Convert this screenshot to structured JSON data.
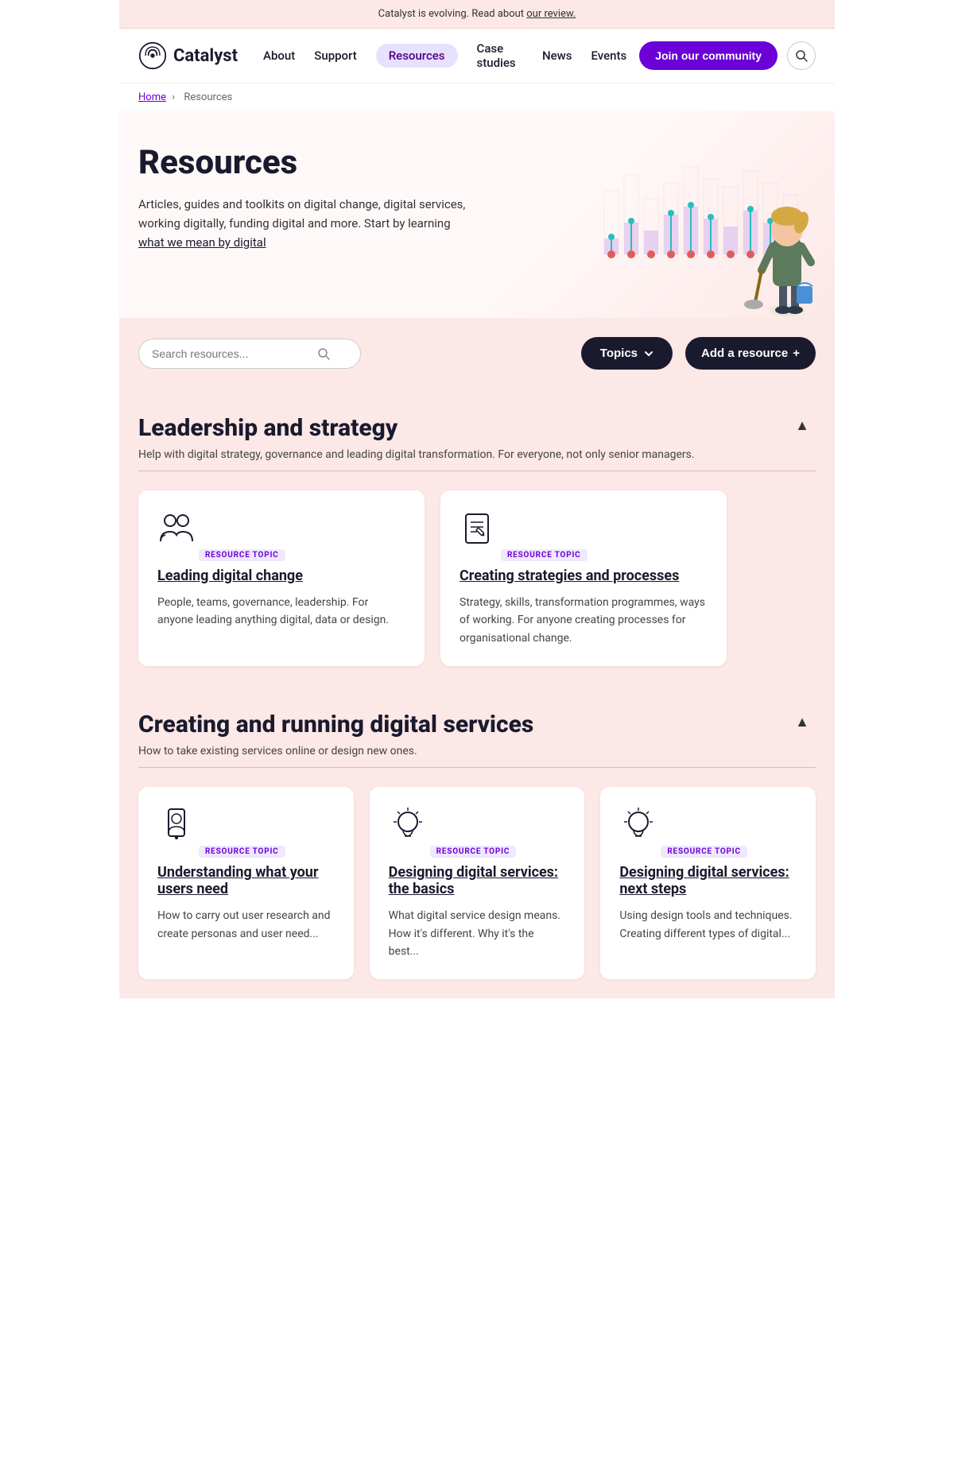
{
  "banner": {
    "text": "Catalyst is evolving. Read about ",
    "link_text": "our review.",
    "link_href": "#"
  },
  "nav": {
    "logo_text": "Catalyst",
    "links": [
      {
        "label": "About",
        "active": false
      },
      {
        "label": "Support",
        "active": false
      },
      {
        "label": "Resources",
        "active": true
      },
      {
        "label": "Case studies",
        "active": false
      },
      {
        "label": "News",
        "active": false
      },
      {
        "label": "Events",
        "active": false
      }
    ],
    "join_label": "Join our community"
  },
  "breadcrumb": {
    "home": "Home",
    "current": "Resources"
  },
  "hero": {
    "title": "Resources",
    "description": "Articles, guides and toolkits on digital change, digital services, working digitally, funding digital and more. Start by learning ",
    "link_text": "what we mean by digital"
  },
  "search": {
    "placeholder": "Search resources...",
    "topics_label": "Topics",
    "add_resource_label": "Add a resource",
    "add_icon": "+"
  },
  "section1": {
    "title": "Leadership and strategy",
    "description": "Help with digital strategy, governance and leading digital transformation. For everyone, not only senior managers."
  },
  "cards_section1": [
    {
      "topic_label": "RESOURCE TOPIC",
      "title": "Leading digital change",
      "description": "People, teams, governance, leadership. For anyone leading anything digital, data or design.",
      "icon": "people"
    },
    {
      "topic_label": "RESOURCE TOPIC",
      "title": "Creating strategies and processes",
      "description": "Strategy, skills, transformation programmes, ways of working. For anyone creating processes for organisational change.",
      "icon": "document"
    }
  ],
  "section2": {
    "title": "Creating and running digital services",
    "description": "How to take existing services online or design new ones."
  },
  "cards_section2": [
    {
      "topic_label": "RESOURCE TOPIC",
      "title": "Understanding what your users need",
      "description": "How to carry out user research and create personas and user need...",
      "icon": "phone"
    },
    {
      "topic_label": "RESOURCE TOPIC",
      "title": "Designing digital services: the basics",
      "description": "What digital service design means. How it's different. Why it's the best...",
      "icon": "bulb"
    },
    {
      "topic_label": "RESOURCE TOPIC",
      "title": "Designing digital services: next steps",
      "description": "Using design tools and techniques. Creating different types of digital...",
      "icon": "bulb"
    }
  ]
}
